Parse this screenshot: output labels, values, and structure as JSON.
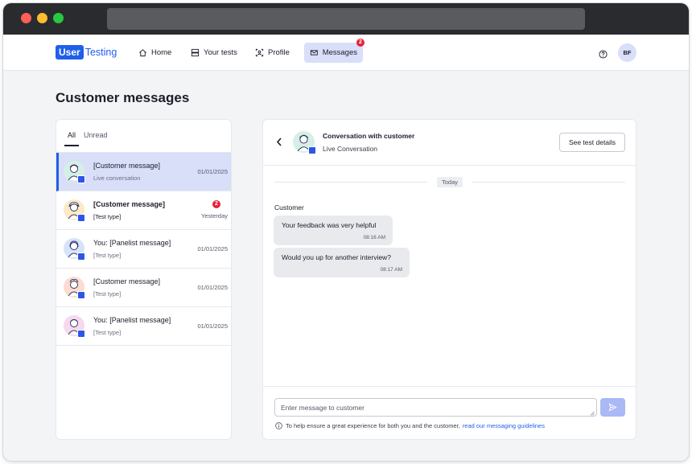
{
  "nav": {
    "logo_user": "User",
    "logo_testing": "Testing",
    "items": [
      {
        "label": "Home",
        "icon": "home-icon"
      },
      {
        "label": "Your tests",
        "icon": "tests-icon"
      },
      {
        "label": "Profile",
        "icon": "profile-icon"
      },
      {
        "label": "Messages",
        "icon": "messages-icon"
      }
    ],
    "messages_badge": "2",
    "avatar_initials": "BF"
  },
  "page": {
    "title": "Customer messages"
  },
  "tabs": {
    "all": "All",
    "unread": "Unread"
  },
  "conversations": [
    {
      "title": "[Customer message]",
      "subtitle": "Live conversation",
      "date": "01/01/2025",
      "selected": true
    },
    {
      "title": "[Customer message]",
      "subtitle": "[Test type]",
      "date": "Yesterday",
      "badge": "2",
      "bold": true
    },
    {
      "title": "You: [Panelist message]",
      "subtitle": "[Test type]",
      "date": "01/01/2025"
    },
    {
      "title": "[Customer message]",
      "subtitle": "[Test type]",
      "date": "01/01/2025"
    },
    {
      "title": "You: [Panelist message]",
      "subtitle": "[Test type]",
      "date": "01/01/2025"
    }
  ],
  "chat": {
    "title": "Conversation with customer",
    "subtitle": "Live Conversation",
    "details_button": "See test details",
    "day_divider": "Today",
    "sender": "Customer",
    "messages": [
      {
        "text": "Your feedback was very helpful",
        "time": "08:16 AM"
      },
      {
        "text": "Would you up for another interview?",
        "time": "08:17 AM"
      }
    ],
    "input_placeholder": "Enter message to customer",
    "info_text": "To help ensure a great experience for both you and the customer,",
    "info_link": "read our messaging guidelines"
  },
  "colors": {
    "brand": "#1f5fea",
    "selected_bg": "#d9def9",
    "badge": "#e8213a"
  }
}
